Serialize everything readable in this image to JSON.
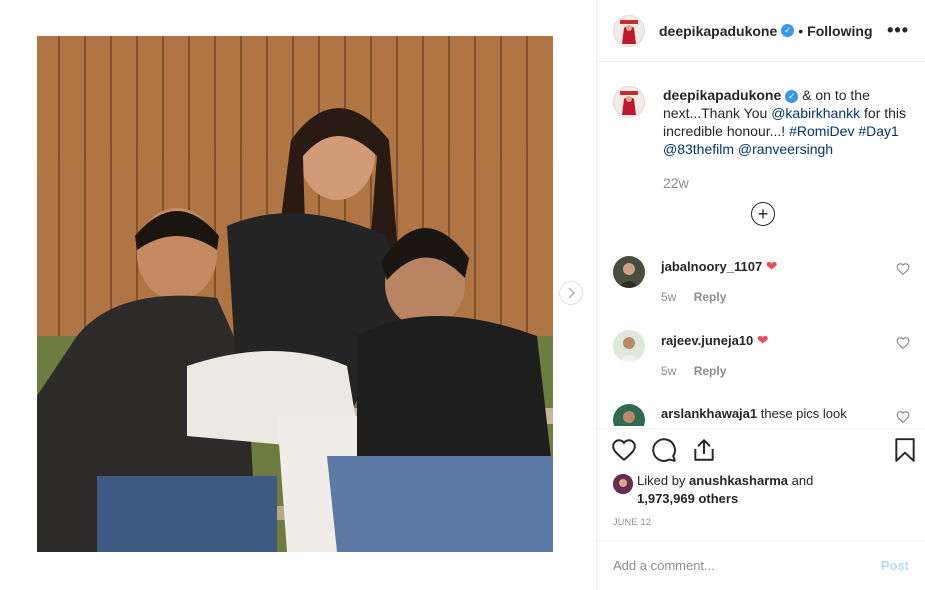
{
  "post": {
    "author": "deepikapadukone",
    "follow_state": "Following",
    "dot": "•",
    "more_label": "•••",
    "verified_glyph": "✓",
    "photo_alt": "Three people laughing together on a wooden bench in front of a fence"
  },
  "caption": {
    "username": "deepikapadukone",
    "parts": [
      {
        "text": "& on to the next...Thank You ",
        "link": false
      },
      {
        "text": "@kabirkhankk",
        "link": true
      },
      {
        "text": " for this incredible honour...! ",
        "link": false
      },
      {
        "text": "#RomiDev",
        "link": true
      },
      {
        "text": " ",
        "link": false
      },
      {
        "text": "#Day1",
        "link": true
      },
      {
        "text": " ",
        "link": false
      },
      {
        "text": "@83thefilm",
        "link": true
      },
      {
        "text": " ",
        "link": false
      },
      {
        "text": "@ranveersingh",
        "link": true
      }
    ],
    "time": "22w",
    "load_more_glyph": "+"
  },
  "comments": [
    {
      "username": "jabalnoory_1107",
      "text": "",
      "has_heart": true,
      "heart": "❤",
      "time": "5w",
      "reply": "Reply"
    },
    {
      "username": "rajeev.juneja10",
      "text": "",
      "has_heart": true,
      "heart": "❤",
      "time": "5w",
      "reply": "Reply"
    },
    {
      "username": "arslankhawaja1",
      "text": "these pics look",
      "has_heart": false,
      "heart": "",
      "time": "",
      "reply": ""
    }
  ],
  "likes": {
    "prefix": "Liked by ",
    "user": "anushkasharma",
    "middle": " and",
    "count": "1,973,969 others"
  },
  "date": "JUNE 12",
  "add_comment": {
    "placeholder": "Add a comment...",
    "post_label": "Post"
  },
  "icons": {
    "like": "heart-outline-icon",
    "comment": "speech-bubble-icon",
    "share": "share-arrow-icon",
    "save": "bookmark-icon",
    "next": "chevron-right-icon",
    "more": "more-options-icon"
  },
  "colors": {
    "verified": "#3897f0",
    "link": "#00376b",
    "heart": "#ed4956",
    "post_disabled": "#b2dffc",
    "muted": "#8e8e8e"
  }
}
